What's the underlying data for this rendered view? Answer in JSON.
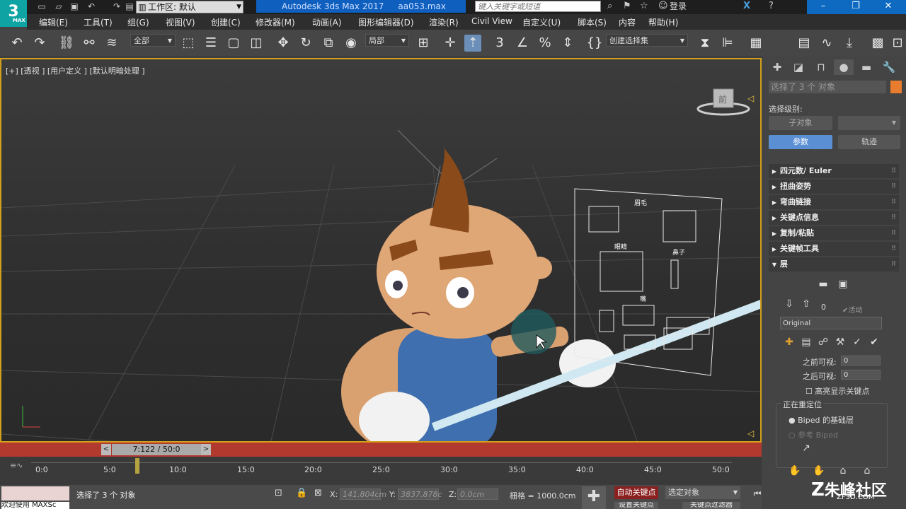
{
  "titlebar": {
    "logo": "3",
    "logo_sub": "MAX",
    "workspace_label": "工作区: 默认",
    "app_name": "Autodesk 3ds Max 2017",
    "file_name": "aa053.max",
    "search_placeholder": "键入关键字或短语",
    "login": "登录"
  },
  "menu": [
    "编辑(E)",
    "工具(T)",
    "组(G)",
    "视图(V)",
    "创建(C)",
    "修改器(M)",
    "动画(A)",
    "图形编辑器(D)",
    "渲染(R)",
    "Civil View",
    "自定义(U)",
    "脚本(S)",
    "内容",
    "帮助(H)"
  ],
  "toolbar": {
    "filter": "全部",
    "coord_system": "局部",
    "selection_set": "创建选择集"
  },
  "viewport": {
    "label": "[+] [透视 ] [用户定义 ] [默认明暗处理 ]",
    "viewcube_face": "前",
    "picker_labels": {
      "head": "眉毛",
      "eyes": "眼睛",
      "nose": "鼻子",
      "mouth": "嘴"
    }
  },
  "timeline": {
    "frame": "7:122 / 50:0",
    "ticks": [
      "0:0",
      "5:0",
      "10:0",
      "15:0",
      "20:0",
      "25:0",
      "30:0",
      "35:0",
      "40:0",
      "45:0",
      "50:0"
    ]
  },
  "status": {
    "message": "选择了 3 个 对象",
    "welcome": "欢迎使用 MAXSc",
    "x_label": "X:",
    "x_value": "141.804cm",
    "y_label": "Y:",
    "y_value": "3837.878c",
    "z_label": "Z:",
    "z_value": "0.0cm",
    "grid": "栅格 = 1000.0cm",
    "auto_key": "自动关键点",
    "filter": "选定对象",
    "set_key": "设置关键点",
    "key_filter": "关键点过滤器"
  },
  "panel": {
    "selection_name": "选择了 3 个 对象",
    "selection_level": "选择级别:",
    "sub_object": "子对象",
    "params_button": "参数",
    "track_button": "轨迹",
    "rollouts": [
      "四元数/ Euler",
      "扭曲姿势",
      "弯曲链接",
      "关键点信息",
      "复制/粘贴",
      "关键帧工具",
      "层"
    ],
    "layer_index": "0",
    "active_label": "活动",
    "layer_name": "Original",
    "before_visible": "之前可视:",
    "before_value": "0",
    "after_visible": "之后可视:",
    "after_value": "0",
    "highlight_keys": "高亮显示关键点",
    "retarget_title": "正在重定位",
    "biped_base": "Biped 的基础层",
    "ref_biped": "参考 Biped"
  },
  "watermark": {
    "brand": "朱峰社区",
    "url": "ZF3D.COM"
  },
  "colors": {
    "accent_blue": "#5b8fd4",
    "viewport_border": "#d4a01a",
    "timebar": "#b2392e",
    "autokey": "#8a2020",
    "object_color": "#e87d30"
  }
}
